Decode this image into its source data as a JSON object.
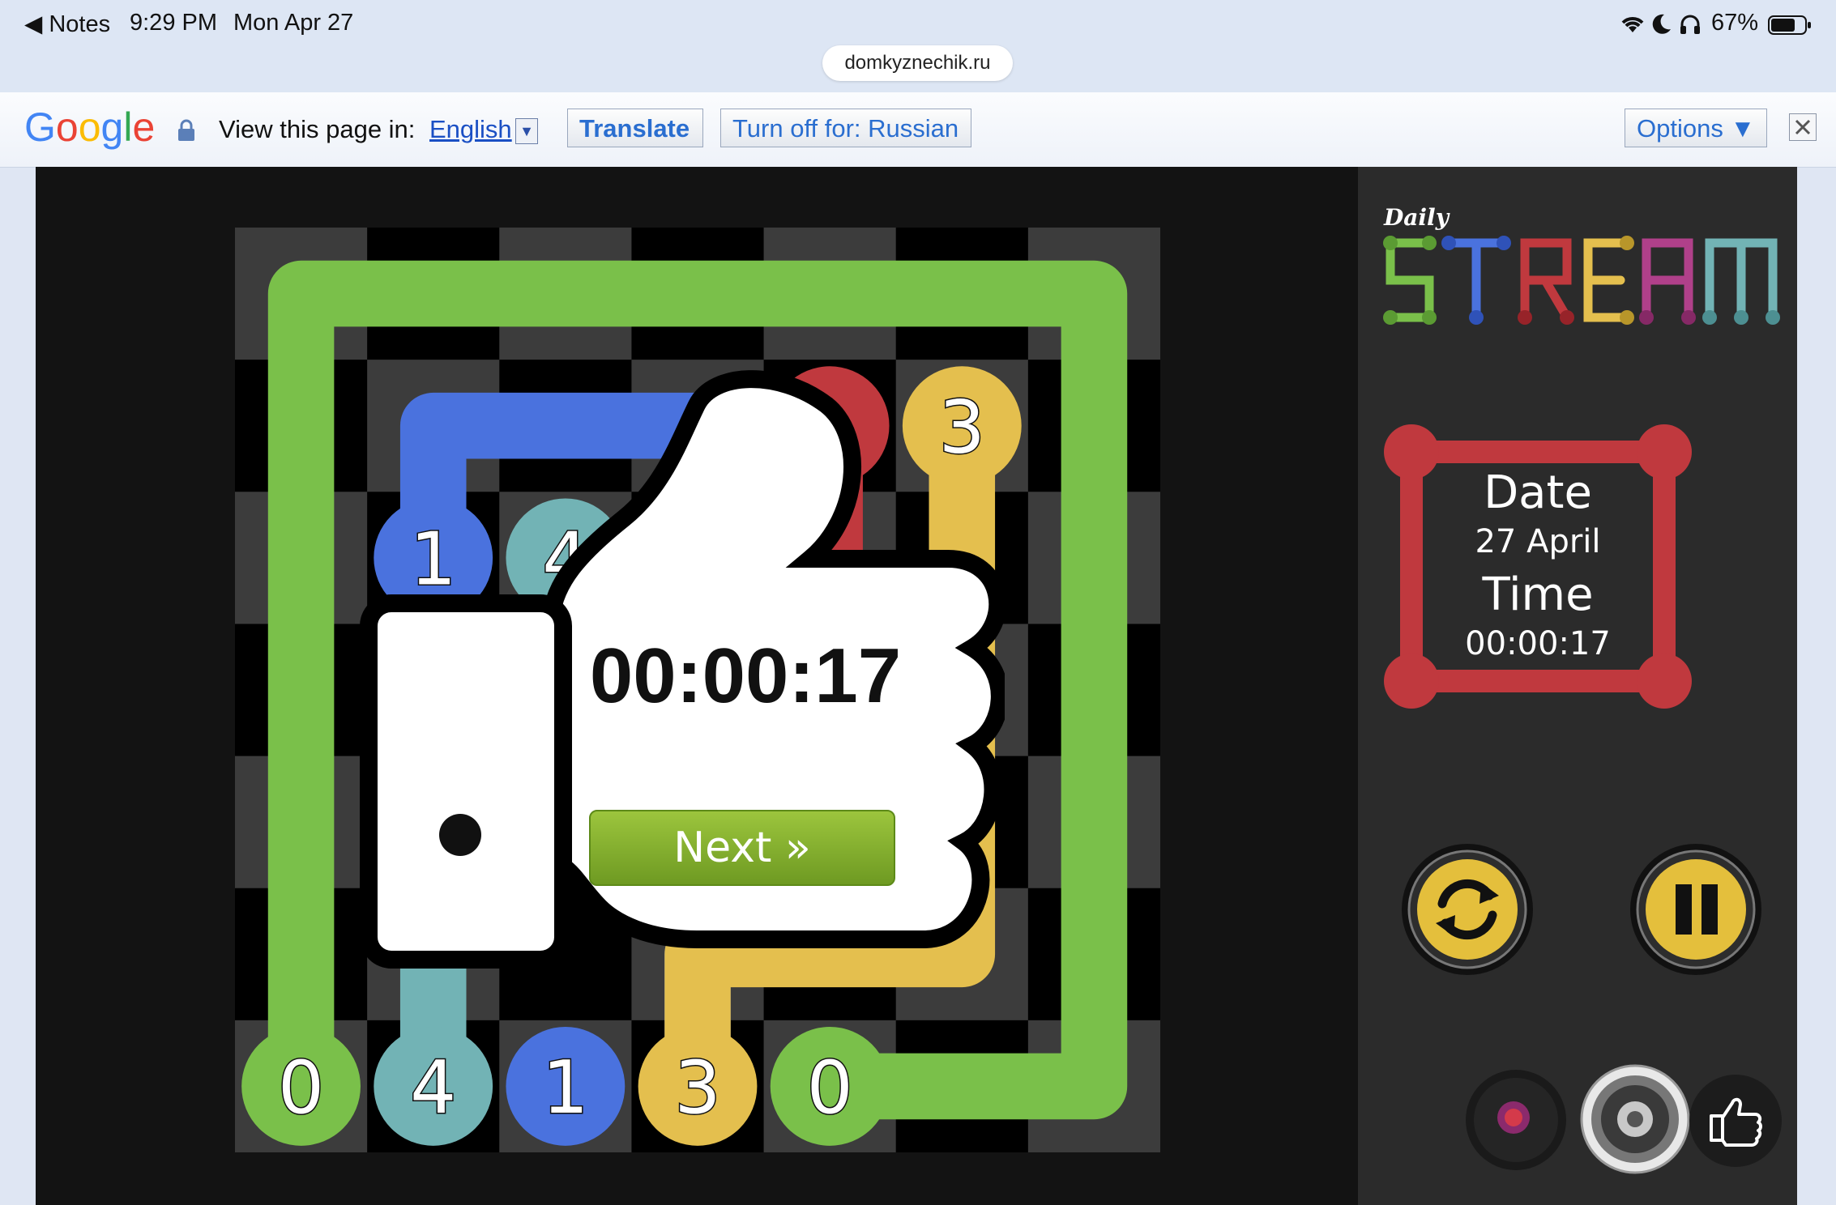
{
  "status_bar": {
    "back_label": "◀ Notes",
    "time": "9:29 PM",
    "date": "Mon Apr 27",
    "battery": "67%",
    "url": "domkyznechik.ru"
  },
  "translate_bar": {
    "logo": "Google",
    "prompt": "View this page in:",
    "language": "English",
    "translate_button": "Translate",
    "turn_off_button": "Turn off for: Russian",
    "options_button": "Options ▼"
  },
  "game": {
    "brand_small": "Daily",
    "brand_large": "STREAM",
    "date_label": "Date",
    "date_value": "27 April",
    "time_label": "Time",
    "time_value": "00:00:17",
    "popup_time": "00:00:17",
    "next_label": "Next »",
    "colors": {
      "green": "#7ac04a",
      "blue": "#4a72de",
      "teal": "#72b3b5",
      "yellow": "#e4bf4e",
      "red": "#c0393e"
    },
    "board_rows": 7,
    "board_cols": 7,
    "endpoints": [
      {
        "label": "1",
        "color": "blue"
      },
      {
        "label": "4",
        "color": "teal"
      },
      {
        "label": "3",
        "color": "yellow"
      },
      {
        "label": "0",
        "color": "green"
      },
      {
        "label": "4",
        "color": "teal"
      },
      {
        "label": "1",
        "color": "blue"
      },
      {
        "label": "3",
        "color": "yellow"
      },
      {
        "label": "0",
        "color": "green"
      }
    ]
  },
  "controls": {
    "restart_icon": "refresh-icon",
    "pause_icon": "pause-icon",
    "record_icon": "record-disc-icon",
    "sound_icon": "speaker-icon",
    "like_icon": "thumbs-up-icon"
  }
}
